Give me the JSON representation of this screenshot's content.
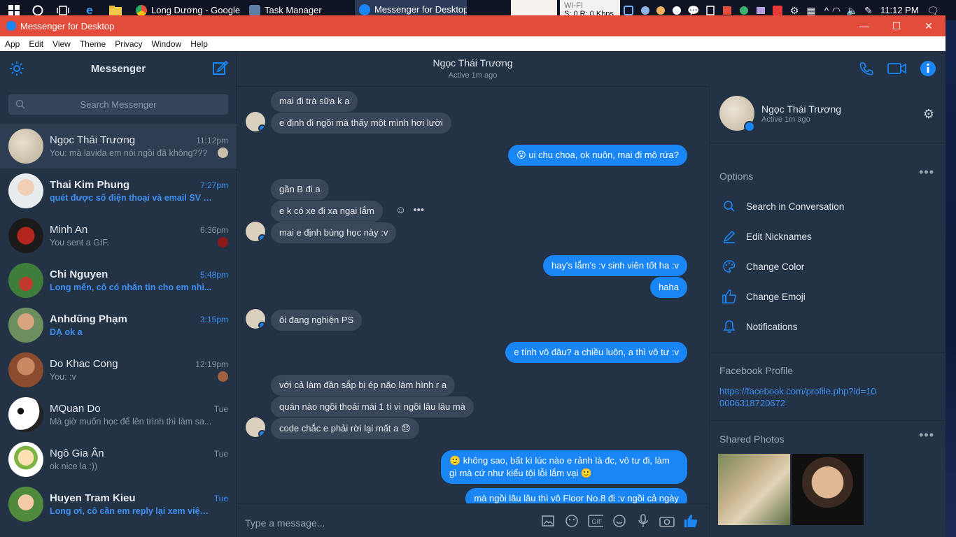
{
  "taskbar": {
    "apps": [
      {
        "label": "Long Dương - Google..."
      },
      {
        "label": "Task Manager"
      },
      {
        "label": "Messenger for Desktop"
      }
    ],
    "net_meter": {
      "line1": "WI-FI",
      "line2": "S: 0 R: 0 Kbps"
    },
    "clock": "11:12 PM"
  },
  "window": {
    "title": "Messenger for Desktop",
    "menu": [
      "App",
      "Edit",
      "View",
      "Theme",
      "Privacy",
      "Window",
      "Help"
    ]
  },
  "sidebar": {
    "title": "Messenger",
    "search_placeholder": "Search Messenger",
    "conversations": [
      {
        "name": "Ngọc Thái Trương",
        "time": "11:12pm",
        "preview": "You: mà lavida em nói ngồi đã không???",
        "unread": false
      },
      {
        "name": "Thai Kim Phung",
        "time": "7:27pm",
        "preview": "quét được số điện thoại và email SV t...",
        "unread": true
      },
      {
        "name": "Minh An",
        "time": "6:36pm",
        "preview": "You sent a GIF.",
        "unread": false
      },
      {
        "name": "Chi Nguyen",
        "time": "5:48pm",
        "preview": "Long mến, cô có nhắn tin cho em nhi...",
        "unread": true
      },
      {
        "name": "Anhdũng Phạm",
        "time": "3:15pm",
        "preview": "DẠ ok a",
        "unread": true
      },
      {
        "name": "Do Khac Cong",
        "time": "12:19pm",
        "preview": "You: :v",
        "unread": false
      },
      {
        "name": "MQuan Do",
        "time": "Tue",
        "preview": "Mà giờ muốn học để lên trình thì làm sa...",
        "unread": false
      },
      {
        "name": "Ngô Gia Ân",
        "time": "Tue",
        "preview": "ok nice la :))",
        "unread": false
      },
      {
        "name": "Huyen Tram Kieu",
        "time": "Tue",
        "preview": "Long ơi, cô cần em reply lại xem việc ...",
        "unread": true
      }
    ]
  },
  "chat": {
    "name": "Ngọc Thái Trương",
    "status": "Active 1m ago",
    "messages": [
      {
        "dir": "in",
        "text": "mai đi trà sữa k a"
      },
      {
        "dir": "in",
        "text": "e định đi ngồi mà thấy một mình hơi lười"
      },
      {
        "dir": "out",
        "text": "ui chu choa, ok nuôn, mai đi mô rứa?",
        "emoji": "😮"
      },
      {
        "dir": "in",
        "text": "gần B đi a"
      },
      {
        "dir": "in",
        "text": "e k có xe đi xa ngại lắm"
      },
      {
        "dir": "in",
        "text": "mai e định bùng học này :v"
      },
      {
        "dir": "out",
        "text": "hay's lắm's :v sinh viên tốt ha :v"
      },
      {
        "dir": "out",
        "text": "haha"
      },
      {
        "dir": "in",
        "text": "ôi đang nghiện PS"
      },
      {
        "dir": "out",
        "text": "e tính vô đâu? a chiều luôn, a thì vô tư :v"
      },
      {
        "dir": "in",
        "text": "với cả làm đần sắp bị ép não làm hình r a"
      },
      {
        "dir": "in",
        "text": "quán nào ngồi thoải mái 1 tí vì ngồi lâu lâu mà"
      },
      {
        "dir": "in",
        "text": "code chắc e phải rời lại mất a 😞"
      },
      {
        "dir": "out",
        "text": "🙂 không sao, bất kì lúc nào e rảnh là đc, vô tư đi, làm"
      },
      {
        "dir": "out",
        "text": "gì mà cứ như kiểu tội lỗi lắm vại 🙂"
      },
      {
        "dir": "out",
        "text": "mà ngồi lâu lâu thì vô Floor No.8 đi :v ngồi cả ngày"
      }
    ],
    "composer_placeholder": "Type a message..."
  },
  "details": {
    "name": "Ngọc Thái Trương",
    "status": "Active 1m ago",
    "options_title": "Options",
    "options": [
      "Search in Conversation",
      "Edit Nicknames",
      "Change Color",
      "Change Emoji",
      "Notifications"
    ],
    "profile_title": "Facebook Profile",
    "profile_link": "https://facebook.com/profile.php?id=100006318720672",
    "photos_title": "Shared Photos"
  },
  "colors": {
    "accent": "#1a86f5",
    "titlebar": "#e34b3b",
    "background": "#243246",
    "incoming_bubble": "#3a4659"
  }
}
